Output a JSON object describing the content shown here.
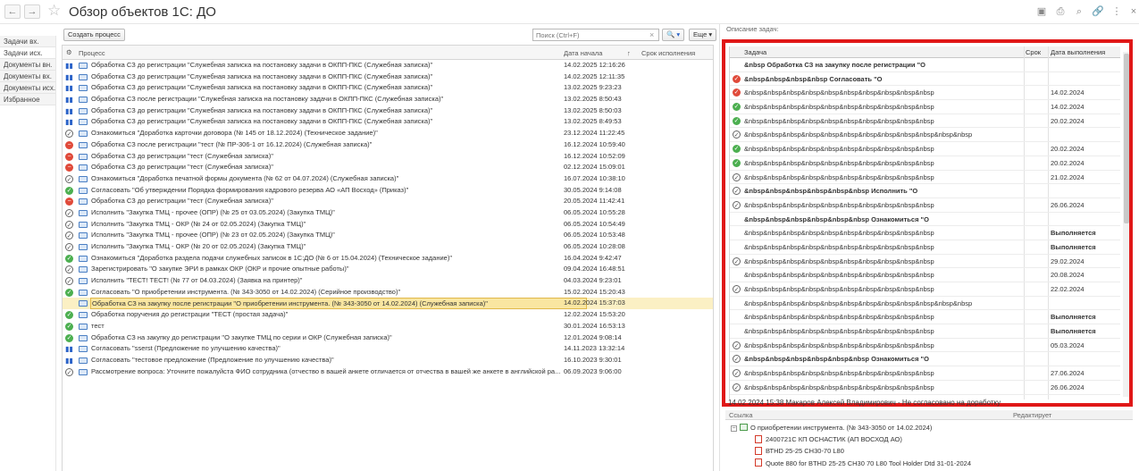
{
  "window": {
    "title": "Обзор объектов 1С: ДО",
    "back_glyph": "←",
    "forward_glyph": "→",
    "star_glyph": "☆",
    "toolbar_icons": [
      {
        "name": "save-icon",
        "glyph": "▣"
      },
      {
        "name": "print-icon",
        "glyph": "⎙"
      },
      {
        "name": "preview-icon",
        "glyph": "⌕"
      },
      {
        "name": "link-icon",
        "glyph": "🔗"
      },
      {
        "name": "more-vertical-icon",
        "glyph": "⋮"
      },
      {
        "name": "close-icon",
        "glyph": "×"
      }
    ]
  },
  "leftnav": {
    "items": [
      "Задачи вх.",
      "Задачи исх.",
      "Документы вн.",
      "Документы вх.",
      "Документы исх.",
      "Избранное"
    ],
    "active_index": 1
  },
  "toolbar": {
    "create_label": "Создать процесс",
    "search_placeholder": "Поиск (Ctrl+F)",
    "search_clear_glyph": "×",
    "search_button_glyph": "🔍 ▾",
    "more_label": "Еще ▾"
  },
  "process_table": {
    "columns": {
      "icons": "⚙",
      "process": "Процесс",
      "start": "Дата начала",
      "sort_glyph": "↑",
      "deadline": "Срок исполнения"
    },
    "rows": [
      {
        "status": "paused",
        "text": "Обработка СЗ до регистрации \"Служебная записка на постановку задачи в ОКПП-ПКС (Служебная записка)\"",
        "date": "14.02.2025 12:16:26"
      },
      {
        "status": "paused",
        "text": "Обработка СЗ до регистрации \"Служебная записка на постановку задачи в ОКПП-ПКС (Служебная записка)\"",
        "date": "14.02.2025 12:11:35"
      },
      {
        "status": "paused",
        "text": "Обработка СЗ до регистрации \"Служебная записка на постановку задачи в ОКПП-ПКС (Служебная записка)\"",
        "date": "13.02.2025 9:23:23"
      },
      {
        "status": "paused",
        "text": "Обработка СЗ после регистрации \"Служебная записка на постановку задачи в ОКПП-ПКС (Служебная записка)\"",
        "date": "13.02.2025 8:50:43"
      },
      {
        "status": "paused",
        "text": "Обработка СЗ до регистрации \"Служебная записка на постановку задачи в ОКПП-ПКС (Служебная записка)\"",
        "date": "13.02.2025 8:50:03"
      },
      {
        "status": "paused",
        "text": "Обработка СЗ до регистрации \"Служебная записка на постановку задачи в ОКПП-ПКС (Служебная записка)\"",
        "date": "13.02.2025 8:49:53"
      },
      {
        "status": "info",
        "text": "Ознакомиться \"Доработка карточки договора (№ 145 от 18.12.2024) (Техническое задание)\"",
        "date": "23.12.2024 11:22:45"
      },
      {
        "status": "stopped",
        "text": "Обработка СЗ после регистрации \"тест (№ ПР-306-1 от 16.12.2024) (Служебная записка)\"",
        "date": "16.12.2024 10:59:40"
      },
      {
        "status": "stopped",
        "text": "Обработка СЗ до регистрации \"тест (Служебная записка)\"",
        "date": "16.12.2024 10:52:09"
      },
      {
        "status": "stopped",
        "text": "Обработка СЗ до регистрации \"тест (Служебная записка)\"",
        "date": "02.12.2024 15:09:01"
      },
      {
        "status": "info",
        "text": "Ознакомиться \"Доработка печатной формы документа (№ 62 от 04.07.2024) (Служебная записка)\"",
        "date": "16.07.2024 10:38:10"
      },
      {
        "status": "done",
        "text": "Согласовать \"Об утверждении Порядка формирования кадрового резерва АО «АП Восход» (Приказ)\"",
        "date": "30.05.2024 9:14:08"
      },
      {
        "status": "stopped",
        "text": "Обработка СЗ до регистрации \"тест (Служебная записка)\"",
        "date": "20.05.2024 11:42:41"
      },
      {
        "status": "info",
        "text": "Исполнить \"Закупка ТМЦ - прочее (ОПР) (№ 25 от 03.05.2024) (Закупка ТМЦ)\"",
        "date": "06.05.2024 10:55:28"
      },
      {
        "status": "info",
        "text": "Исполнить \"Закупка ТМЦ - ОКР (№ 24 от 02.05.2024) (Закупка ТМЦ)\"",
        "date": "06.05.2024 10:54:49"
      },
      {
        "status": "info",
        "text": "Исполнить \"Закупка ТМЦ - прочее (ОПР) (№ 23 от 02.05.2024) (Закупка ТМЦ)\"",
        "date": "06.05.2024 10:53:48"
      },
      {
        "status": "info",
        "text": "Исполнить \"Закупка ТМЦ - ОКР (№ 20 от 02.05.2024) (Закупка ТМЦ)\"",
        "date": "06.05.2024 10:28:08"
      },
      {
        "status": "done",
        "text": "Ознакомиться \"Доработка раздела подачи служебных записок в 1С:ДО (№ 6 от 15.04.2024) (Техническое задание)\"",
        "date": "16.04.2024 9:42:47"
      },
      {
        "status": "info",
        "text": "Зарегистрировать \"О закупке ЭРИ в рамках ОКР (ОКР и прочие опытные работы)\"",
        "date": "09.04.2024 16:48:51"
      },
      {
        "status": "info",
        "text": "Исполнить \"ТЕСТ! ТЕСТ! (№ 77 от 04.03.2024) (Заявка на принтер)\"",
        "date": "04.03.2024 9:23:01"
      },
      {
        "status": "done",
        "text": "Согласовать \"О приобретении инструмента. (№ 343-3050 от 14.02.2024) (Серийное производство)\"",
        "date": "15.02.2024 15:20:43"
      },
      {
        "status": "selected",
        "text": "Обработка СЗ на закупку после регистрации \"О приобретении инструмента. (№ 343-3050 от 14.02.2024) (Служебная записка)\"",
        "date": "14.02.2024 15:37:03"
      },
      {
        "status": "done",
        "text": "Обработка поручения до регистрации \"ТЕСТ (простая задача)\"",
        "date": "12.02.2024 15:53:20"
      },
      {
        "status": "done",
        "text": "тест",
        "date": "30.01.2024 16:53:13"
      },
      {
        "status": "done",
        "text": "Обработка СЗ на закупку до регистрации \"О закупке ТМЦ по серии и ОКР (Служебная записка)\"",
        "date": "12.01.2024 9:08:14"
      },
      {
        "status": "paused",
        "text": "Согласовать \"sserst (Предложение по улучшению качества)\"",
        "date": "14.11.2023 13:32:14"
      },
      {
        "status": "paused",
        "text": "Согласовать \"тестовое предложение (Предложение по улучшению качества)\"",
        "date": "16.10.2023 9:30:01"
      },
      {
        "status": "info",
        "text": "Рассмотрение вопроса: Уточните пожалуйста ФИО сотрудника (отчество в вашей анкете отличается от отчества в вашей же анкете в английской ра...",
        "date": "06.09.2023 9:06:00"
      }
    ]
  },
  "task_panel": {
    "label": "Описание задач:",
    "columns": {
      "task": "Задача",
      "deadline": "Срок",
      "done": "Дата выполнения"
    },
    "rows": [
      {
        "status": "none",
        "text": "&nbsp Обработка СЗ на закупку после регистрации \"О",
        "bold": true,
        "date": "",
        "date_bold": false
      },
      {
        "status": "stopped",
        "text": "&nbsp&nbsp&nbsp&nbsp Согласовать \"О",
        "bold": true,
        "date": "",
        "date_bold": false
      },
      {
        "status": "stopped",
        "text": "&nbsp&nbsp&nbsp&nbsp&nbsp&nbsp&nbsp&nbsp&nbsp&nbsp",
        "bold": false,
        "date": "14.02.2024",
        "date_bold": false
      },
      {
        "status": "done",
        "text": "&nbsp&nbsp&nbsp&nbsp&nbsp&nbsp&nbsp&nbsp&nbsp&nbsp",
        "bold": false,
        "date": "14.02.2024",
        "date_bold": false
      },
      {
        "status": "done",
        "text": "&nbsp&nbsp&nbsp&nbsp&nbsp&nbsp&nbsp&nbsp&nbsp&nbsp",
        "bold": false,
        "date": "20.02.2024",
        "date_bold": false
      },
      {
        "status": "info",
        "text": "&nbsp&nbsp&nbsp&nbsp&nbsp&nbsp&nbsp&nbsp&nbsp&nbsp&nbsp&nbsp",
        "bold": false,
        "date": "",
        "date_bold": false
      },
      {
        "status": "done",
        "text": "&nbsp&nbsp&nbsp&nbsp&nbsp&nbsp&nbsp&nbsp&nbsp&nbsp",
        "bold": false,
        "date": "20.02.2024",
        "date_bold": false
      },
      {
        "status": "done",
        "text": "&nbsp&nbsp&nbsp&nbsp&nbsp&nbsp&nbsp&nbsp&nbsp&nbsp",
        "bold": false,
        "date": "20.02.2024",
        "date_bold": false
      },
      {
        "status": "info",
        "text": "&nbsp&nbsp&nbsp&nbsp&nbsp&nbsp&nbsp&nbsp&nbsp&nbsp",
        "bold": false,
        "date": "21.02.2024",
        "date_bold": false
      },
      {
        "status": "info",
        "text": "&nbsp&nbsp&nbsp&nbsp&nbsp&nbsp Исполнить \"О",
        "bold": true,
        "date": "",
        "date_bold": false
      },
      {
        "status": "info",
        "text": "&nbsp&nbsp&nbsp&nbsp&nbsp&nbsp&nbsp&nbsp&nbsp&nbsp",
        "bold": false,
        "date": "26.06.2024",
        "date_bold": false
      },
      {
        "status": "none",
        "text": "&nbsp&nbsp&nbsp&nbsp&nbsp&nbsp Ознакомиться \"О",
        "bold": true,
        "date": "",
        "date_bold": false
      },
      {
        "status": "none",
        "text": "&nbsp&nbsp&nbsp&nbsp&nbsp&nbsp&nbsp&nbsp&nbsp&nbsp",
        "bold": false,
        "date": "Выполняется",
        "date_bold": true
      },
      {
        "status": "none",
        "text": "&nbsp&nbsp&nbsp&nbsp&nbsp&nbsp&nbsp&nbsp&nbsp&nbsp",
        "bold": false,
        "date": "Выполняется",
        "date_bold": true
      },
      {
        "status": "info",
        "text": "&nbsp&nbsp&nbsp&nbsp&nbsp&nbsp&nbsp&nbsp&nbsp&nbsp",
        "bold": false,
        "date": "29.02.2024",
        "date_bold": false
      },
      {
        "status": "none",
        "text": "&nbsp&nbsp&nbsp&nbsp&nbsp&nbsp&nbsp&nbsp&nbsp&nbsp",
        "bold": false,
        "date": "20.08.2024",
        "date_bold": false
      },
      {
        "status": "info",
        "text": "&nbsp&nbsp&nbsp&nbsp&nbsp&nbsp&nbsp&nbsp&nbsp&nbsp",
        "bold": false,
        "date": "22.02.2024",
        "date_bold": false
      },
      {
        "status": "none",
        "text": "&nbsp&nbsp&nbsp&nbsp&nbsp&nbsp&nbsp&nbsp&nbsp&nbsp&nbsp&nbsp",
        "bold": false,
        "date": "",
        "date_bold": false
      },
      {
        "status": "none",
        "text": "&nbsp&nbsp&nbsp&nbsp&nbsp&nbsp&nbsp&nbsp&nbsp&nbsp",
        "bold": false,
        "date": "Выполняется",
        "date_bold": true
      },
      {
        "status": "none",
        "text": "&nbsp&nbsp&nbsp&nbsp&nbsp&nbsp&nbsp&nbsp&nbsp&nbsp",
        "bold": false,
        "date": "Выполняется",
        "date_bold": true
      },
      {
        "status": "info",
        "text": "&nbsp&nbsp&nbsp&nbsp&nbsp&nbsp&nbsp&nbsp&nbsp&nbsp",
        "bold": false,
        "date": "05.03.2024",
        "date_bold": false
      },
      {
        "status": "info",
        "text": "&nbsp&nbsp&nbsp&nbsp&nbsp&nbsp Ознакомиться \"О",
        "bold": true,
        "date": "",
        "date_bold": false
      },
      {
        "status": "info",
        "text": "&nbsp&nbsp&nbsp&nbsp&nbsp&nbsp&nbsp&nbsp&nbsp&nbsp",
        "bold": false,
        "date": "27.06.2024",
        "date_bold": false
      },
      {
        "status": "info",
        "text": "&nbsp&nbsp&nbsp&nbsp&nbsp&nbsp&nbsp&nbsp&nbsp&nbsp",
        "bold": false,
        "date": "26.06.2024",
        "date_bold": false
      }
    ],
    "below_text": "14.02.2024 15:38  Макаров Алексей Владимирович - Не согласовано на доработку"
  },
  "links": {
    "columns": {
      "link": "Ссылка",
      "edit": "Редактирует"
    },
    "root": "О приобретении инструмента. (№ 343-3050 от 14.02.2024)",
    "collapse_glyph": "−",
    "files": [
      "2400721С КП ОСНАСТИК (АП ВОСХОД АО)",
      "ВТНD 25-25 СН30-70 L80",
      "Quote 880 for BTHD 25-25 CH30 70 L80 Tool Holder Dtd 31-01-2024"
    ]
  },
  "colors": {
    "highlight": "#e01818",
    "selected_row": "#fbf0c4",
    "done": "#4caf50",
    "stopped": "#e04a3a",
    "paused": "#2b63c8"
  }
}
